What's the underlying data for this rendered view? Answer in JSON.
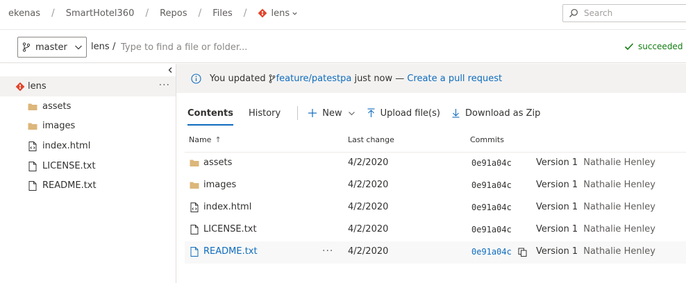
{
  "breadcrumb": {
    "items": [
      "ekenas",
      "SmartHotel360",
      "Repos",
      "Files"
    ],
    "repo": "lens"
  },
  "search": {
    "placeholder": "Search"
  },
  "toolbar": {
    "branch": "master",
    "path_root": "lens",
    "path_separator": "/",
    "path_placeholder": "Type to find a file or folder...",
    "status": "succeeded"
  },
  "tree": {
    "root": "lens",
    "items": [
      {
        "label": "assets",
        "icon": "folder-icon"
      },
      {
        "label": "images",
        "icon": "folder-icon"
      },
      {
        "label": "index.html",
        "icon": "code-file-icon"
      },
      {
        "label": "LICENSE.txt",
        "icon": "file-icon"
      },
      {
        "label": "README.txt",
        "icon": "file-icon"
      }
    ],
    "more": "···"
  },
  "banner": {
    "prefix": "You updated",
    "branch": "feature/patestpa",
    "middle": " just now — ",
    "link": "Create a pull request"
  },
  "tabs": [
    {
      "label": "Contents",
      "active": true
    },
    {
      "label": "History",
      "active": false
    }
  ],
  "commands": {
    "new": "New",
    "upload": "Upload file(s)",
    "download": "Download as Zip"
  },
  "table": {
    "columns": {
      "name": "Name",
      "name_sort": "↑",
      "last_change": "Last change",
      "commits": "Commits"
    },
    "rows": [
      {
        "name": "assets",
        "icon": "folder-icon",
        "date": "4/2/2020",
        "commit": "0e91a04c",
        "message": "Version 1",
        "author": "Nathalie Henley"
      },
      {
        "name": "images",
        "icon": "folder-icon",
        "date": "4/2/2020",
        "commit": "0e91a04c",
        "message": "Version 1",
        "author": "Nathalie Henley"
      },
      {
        "name": "index.html",
        "icon": "code-file-icon",
        "date": "4/2/2020",
        "commit": "0e91a04c",
        "message": "Version 1",
        "author": "Nathalie Henley"
      },
      {
        "name": "LICENSE.txt",
        "icon": "file-icon",
        "date": "4/2/2020",
        "commit": "0e91a04c",
        "message": "Version 1",
        "author": "Nathalie Henley"
      },
      {
        "name": "README.txt",
        "icon": "file-icon",
        "date": "4/2/2020",
        "commit": "0e91a04c",
        "message": "Version 1",
        "author": "Nathalie Henley",
        "more": "···"
      }
    ]
  },
  "colors": {
    "accent": "#0f6cbd",
    "success": "#107c10",
    "git": "#e3442b",
    "folder": "#dcb67a"
  }
}
